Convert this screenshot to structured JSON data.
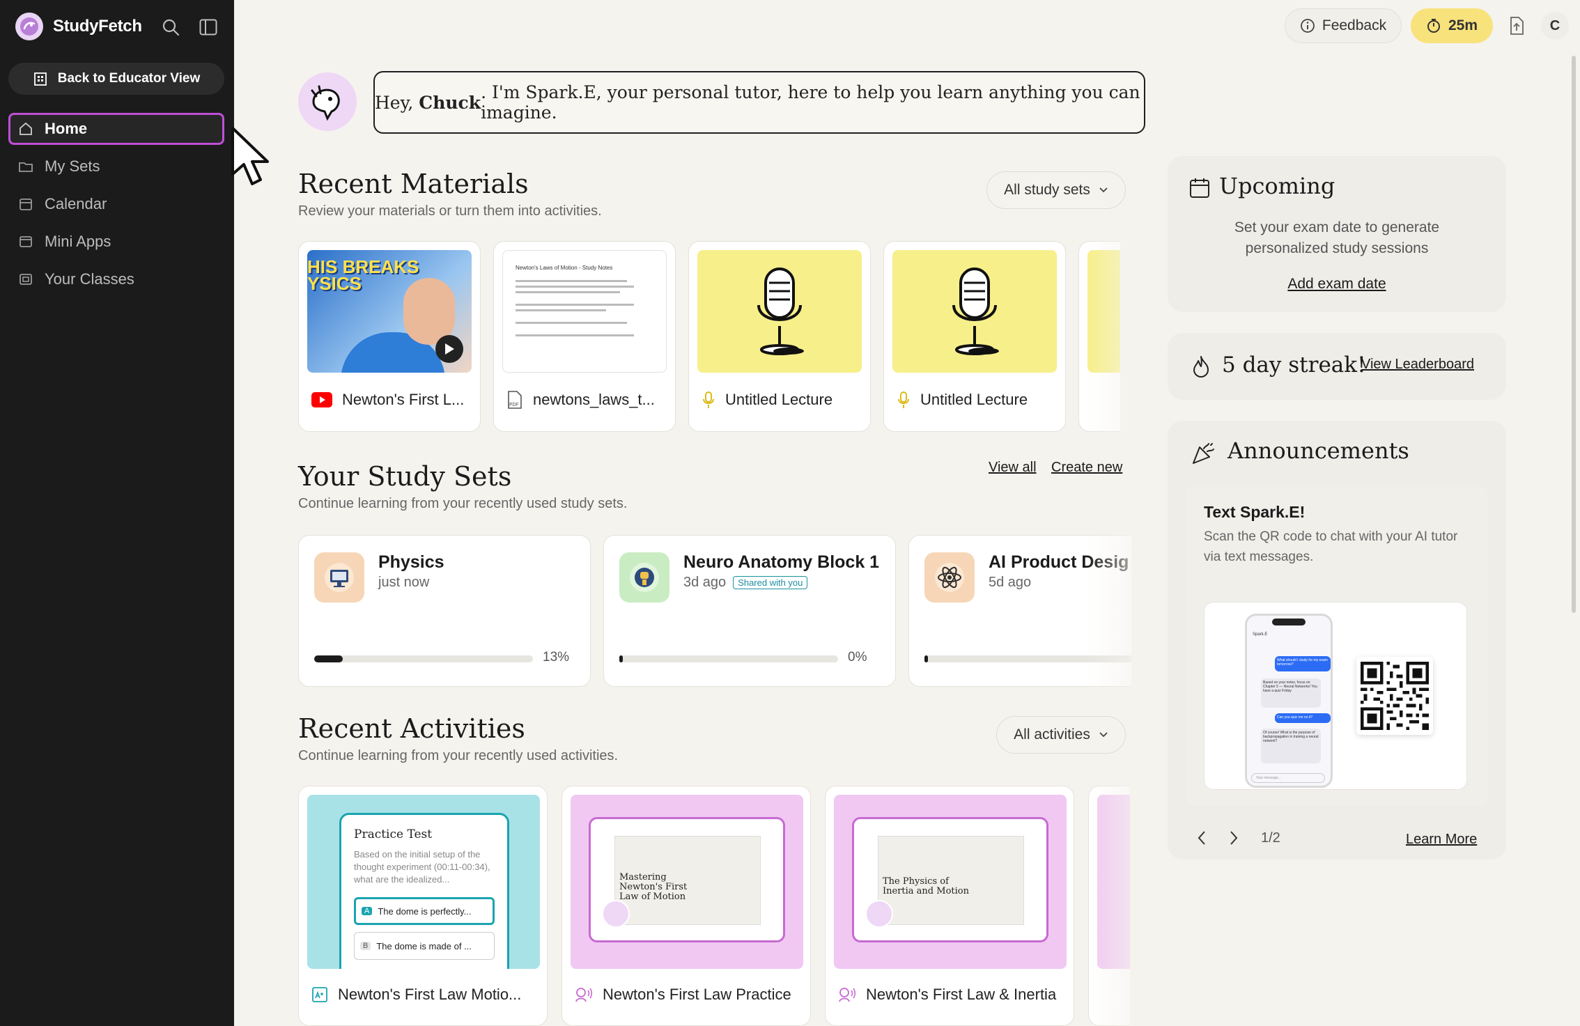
{
  "app": {
    "name": "StudyFetch"
  },
  "sidebar": {
    "back_button": "Back to Educator View",
    "items": [
      {
        "label": "Home",
        "icon": "home-icon"
      },
      {
        "label": "My Sets",
        "icon": "folder-icon"
      },
      {
        "label": "Calendar",
        "icon": "calendar-icon"
      },
      {
        "label": "Mini Apps",
        "icon": "app-window-icon"
      },
      {
        "label": "Your Classes",
        "icon": "classes-icon"
      }
    ]
  },
  "topbar": {
    "feedback": "Feedback",
    "timer": "25m",
    "avatar_initial": "C"
  },
  "greeting": {
    "prefix": "Hey, ",
    "name": "Chuck",
    "message": ". I'm Spark.E, your personal tutor, here to help you learn anything you can imagine."
  },
  "materials": {
    "title": "Recent Materials",
    "subtitle": "Review your materials or turn them into activities.",
    "filter": "All study sets",
    "items": [
      {
        "label": "Newton's First L...",
        "type": "youtube",
        "thumb_text": "HIS BREAKS\nYSICS"
      },
      {
        "label": "newtons_laws_t...",
        "type": "pdf",
        "thumb_title": "Newton's Laws of Motion - Study Notes"
      },
      {
        "label": "Untitled Lecture",
        "type": "audio"
      },
      {
        "label": "Untitled Lecture",
        "type": "audio"
      }
    ]
  },
  "study_sets": {
    "title": "Your Study Sets",
    "subtitle": "Continue learning from your recently used study sets.",
    "view_all": "View all",
    "create_new": "Create new",
    "items": [
      {
        "title": "Physics",
        "time": "just now",
        "progress": 13,
        "progress_label": "13%",
        "badge": ""
      },
      {
        "title": "Neuro Anatomy Block 1",
        "time": "3d ago",
        "progress": 0,
        "progress_label": "0%",
        "badge": "Shared with you"
      },
      {
        "title": "AI Product Desig",
        "time": "5d ago",
        "progress": 0,
        "progress_label": "",
        "badge": ""
      }
    ]
  },
  "activities": {
    "title": "Recent Activities",
    "subtitle": "Continue learning from your recently used activities.",
    "filter": "All activities",
    "items": [
      {
        "label": "Newton's First Law Motio...",
        "type": "practice-test",
        "test_title": "Practice Test",
        "test_question": "Based on the initial setup of the thought experiment (00:11-00:34), what are the idealized...",
        "option_a": "The dome is perfectly...",
        "option_b": "The dome is made of ..."
      },
      {
        "label": "Newton's First Law Practice",
        "type": "audio-lesson",
        "slide_title": "Mastering Newton's First Law of Motion"
      },
      {
        "label": "Newton's First Law & Inertia",
        "type": "audio-lesson",
        "slide_title": "The Physics of Inertia and Motion"
      }
    ]
  },
  "upcoming": {
    "title": "Upcoming",
    "text": "Set your exam date to generate personalized study sessions",
    "link": "Add exam date"
  },
  "streak": {
    "label": "5 day streak!",
    "link": "View Leaderboard"
  },
  "announcements": {
    "title": "Announcements",
    "card_title": "Text Spark.E!",
    "card_text": "Scan the QR code to chat with your AI tutor via text messages.",
    "phone_header": "Spark.E",
    "msg1": "What should I study for my exam tomorrow?",
    "msg2": "Based on your notes, focus on Chapter 5 — Neural Networks! You have a quiz Friday",
    "msg3": "Can you quiz me on it?",
    "msg4": "Of course! What is the purpose of backpropagation in training a neural network?",
    "input_placeholder": "Your message...",
    "pager": "1/2",
    "learn_more": "Learn More"
  },
  "colors": {
    "accent": "#c04fd8",
    "timer": "#f8e27c",
    "audio_thumb": "#f7ef8a",
    "practice_thumb": "#a9e2e6",
    "lesson_thumb": "#f0c8f2"
  }
}
